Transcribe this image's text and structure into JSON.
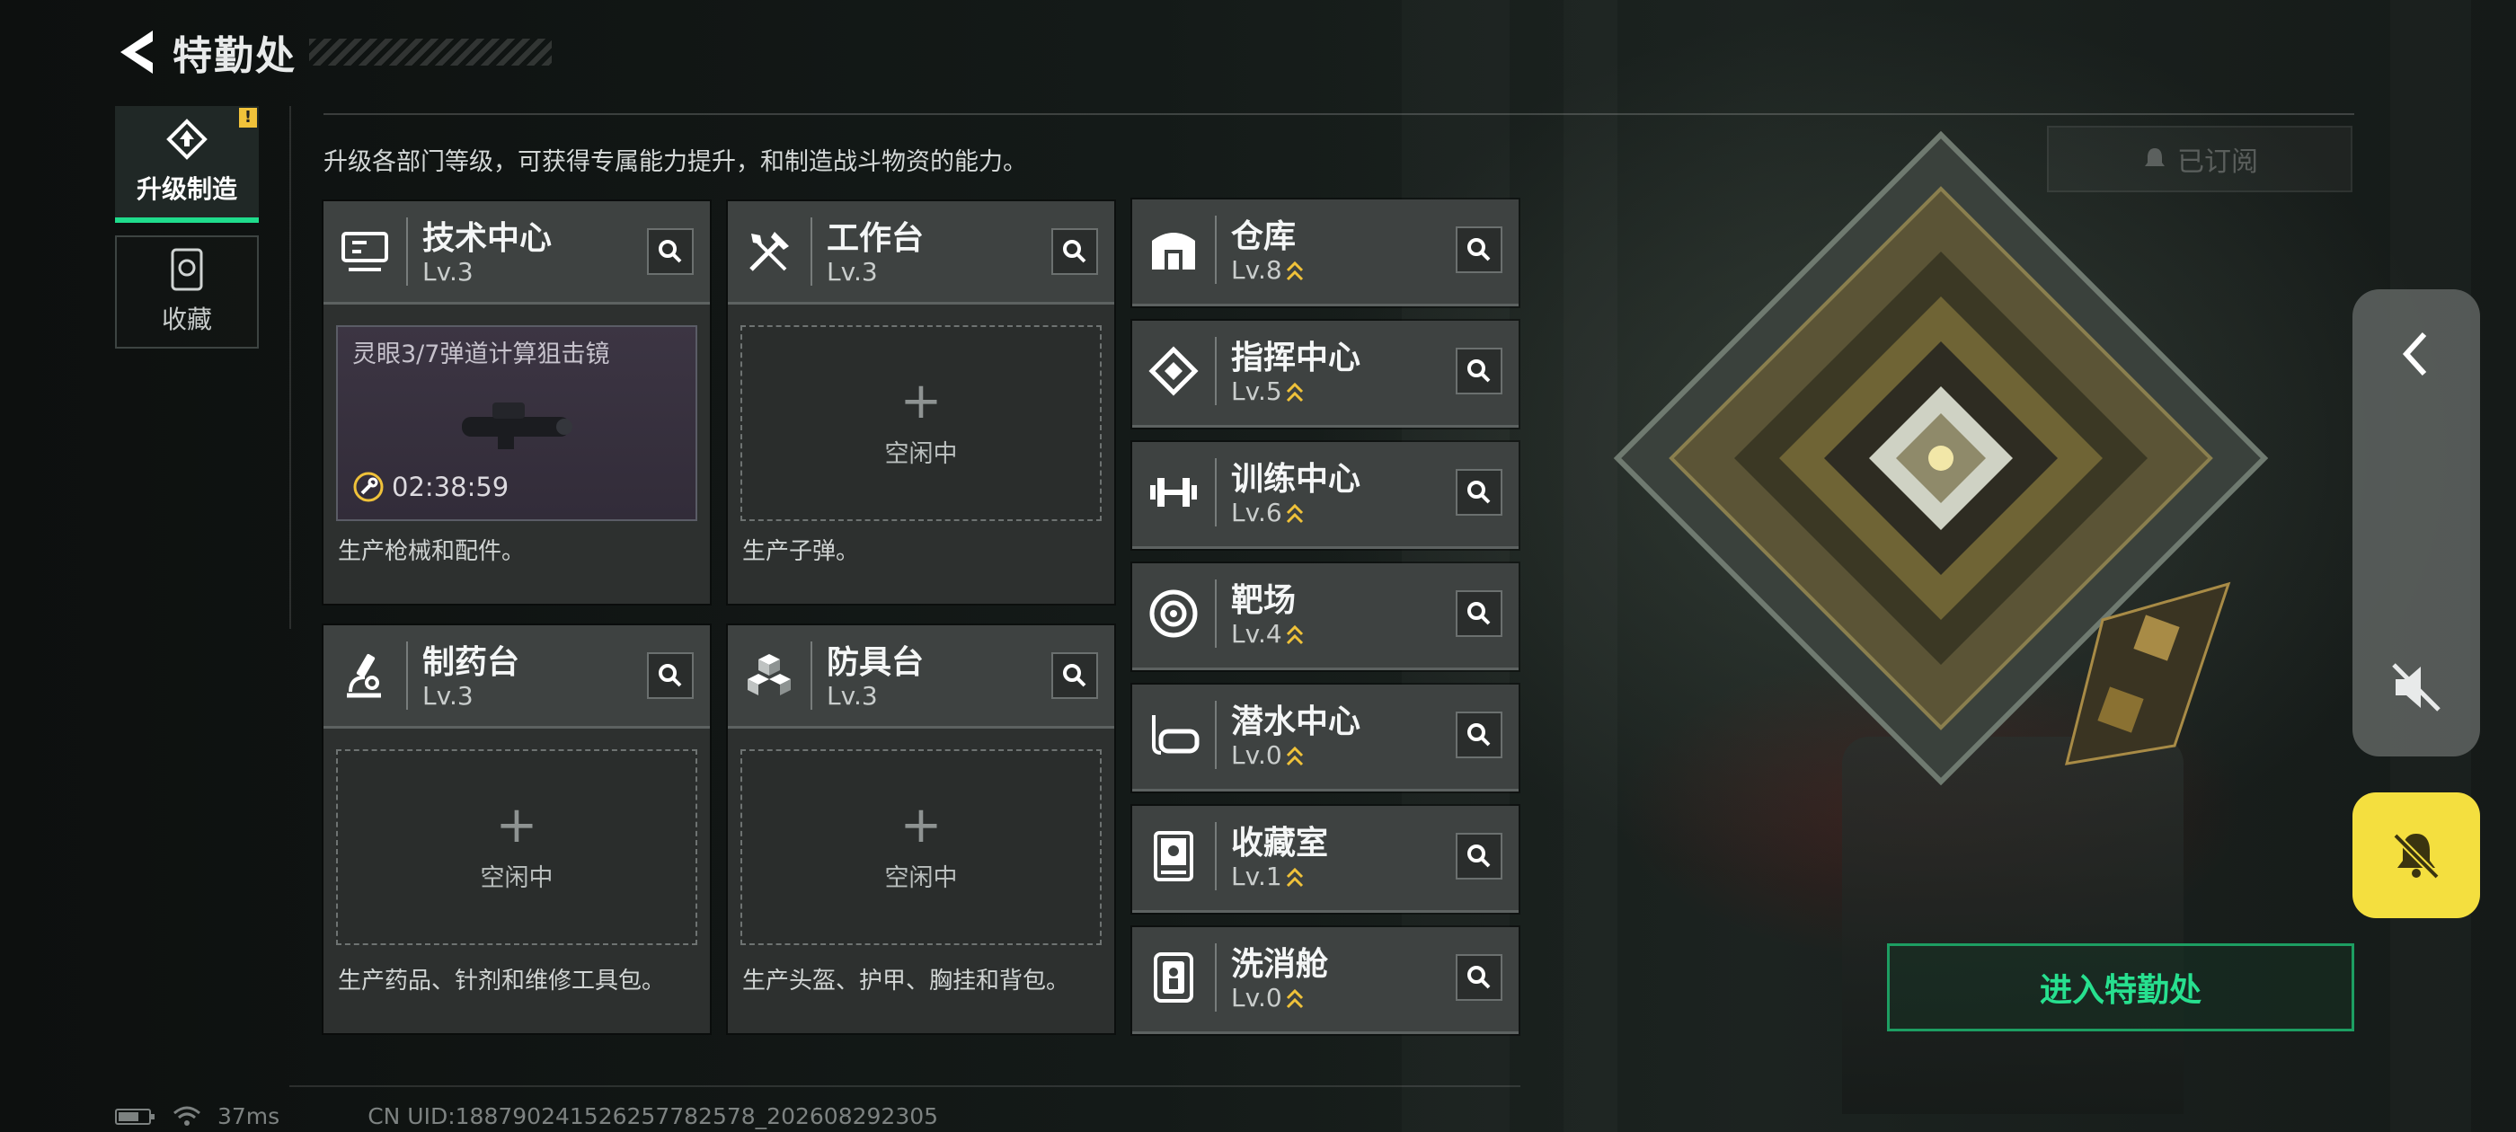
{
  "header": {
    "title": "特勤处"
  },
  "tabs": [
    {
      "label": "升级制造",
      "badge": "!"
    },
    {
      "label": "收藏"
    }
  ],
  "intro": "升级各部门等级，可获得专属能力提升，和制造战斗物资的能力。",
  "subscribed_label": "已订阅",
  "stations": [
    {
      "name": "技术中心",
      "level": "Lv.3",
      "busy": true,
      "item": "灵眼3/7弹道计算狙击镜",
      "timer": "02:38:59",
      "desc": "生产枪械和配件。"
    },
    {
      "name": "工作台",
      "level": "Lv.3",
      "busy": false,
      "idle_text": "空闲中",
      "desc": "生产子弹。"
    },
    {
      "name": "制药台",
      "level": "Lv.3",
      "busy": false,
      "idle_text": "空闲中",
      "desc": "生产药品、针剂和维修工具包。"
    },
    {
      "name": "防具台",
      "level": "Lv.3",
      "busy": false,
      "idle_text": "空闲中",
      "desc": "生产头盔、护甲、胸挂和背包。"
    }
  ],
  "facilities": [
    {
      "name": "仓库",
      "level": "Lv.8"
    },
    {
      "name": "指挥中心",
      "level": "Lv.5"
    },
    {
      "name": "训练中心",
      "level": "Lv.6"
    },
    {
      "name": "靶场",
      "level": "Lv.4"
    },
    {
      "name": "潜水中心",
      "level": "Lv.0"
    },
    {
      "name": "收藏室",
      "level": "Lv.1"
    },
    {
      "name": "洗消舱",
      "level": "Lv.0"
    }
  ],
  "enter_button": "进入特勤处",
  "status": {
    "ping": "37ms",
    "uid": "CN UID:18879024152625778257​8_202608292305"
  },
  "colors": {
    "accent": "#1fdc8c",
    "levelup": "#f0c23a",
    "bell": "#f4df3f"
  }
}
